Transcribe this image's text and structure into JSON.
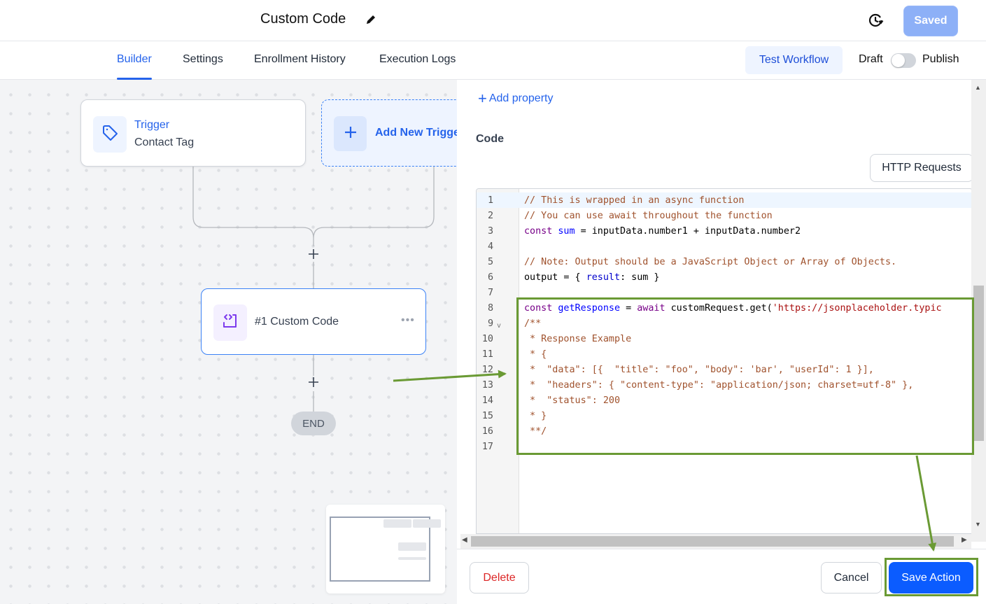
{
  "header": {
    "title": "Custom Code",
    "saved_label": "Saved"
  },
  "tabs": [
    {
      "label": "Builder",
      "active": true
    },
    {
      "label": "Settings",
      "active": false
    },
    {
      "label": "Enrollment History",
      "active": false
    },
    {
      "label": "Execution Logs",
      "active": false
    }
  ],
  "toolbar": {
    "test_workflow_label": "Test Workflow",
    "draft_label": "Draft",
    "publish_label": "Publish",
    "publish_toggle_on": false
  },
  "canvas": {
    "trigger": {
      "title": "Trigger",
      "subtitle": "Contact Tag",
      "icon": "tag-icon"
    },
    "add_trigger": {
      "label": "Add New Trigger",
      "icon": "plus-icon"
    },
    "action": {
      "label": "#1 Custom Code",
      "icon": "code-icon"
    },
    "end_label": "END"
  },
  "panel": {
    "add_property_label": "Add property",
    "code_label": "Code",
    "http_requests_label": "HTTP Requests",
    "code_lines": [
      "// This is wrapped in an async function",
      "// You can use await throughout the function",
      "const sum = inputData.number1 + inputData.number2",
      "",
      "// Note: Output should be a JavaScript Object or Array of Objects.",
      "output = { result: sum }",
      "",
      "const getResponse = await customRequest.get('https://jsonplaceholder.typic",
      "/**",
      " * Response Example",
      " * {",
      " *  \"data\": [{  \"title\": \"foo\", \"body\": 'bar', \"userId\": 1 }],",
      " *  \"headers\": { \"content-type\": \"application/json; charset=utf-8\" },",
      " *  \"status\": 200",
      " * }",
      " **/",
      ""
    ],
    "delete_label": "Delete",
    "cancel_label": "Cancel",
    "save_label": "Save Action"
  },
  "colors": {
    "accent": "#2563eb",
    "save_button": "#0b5cff",
    "annotation": "#6a9a34",
    "delete_text": "#dc2626"
  }
}
